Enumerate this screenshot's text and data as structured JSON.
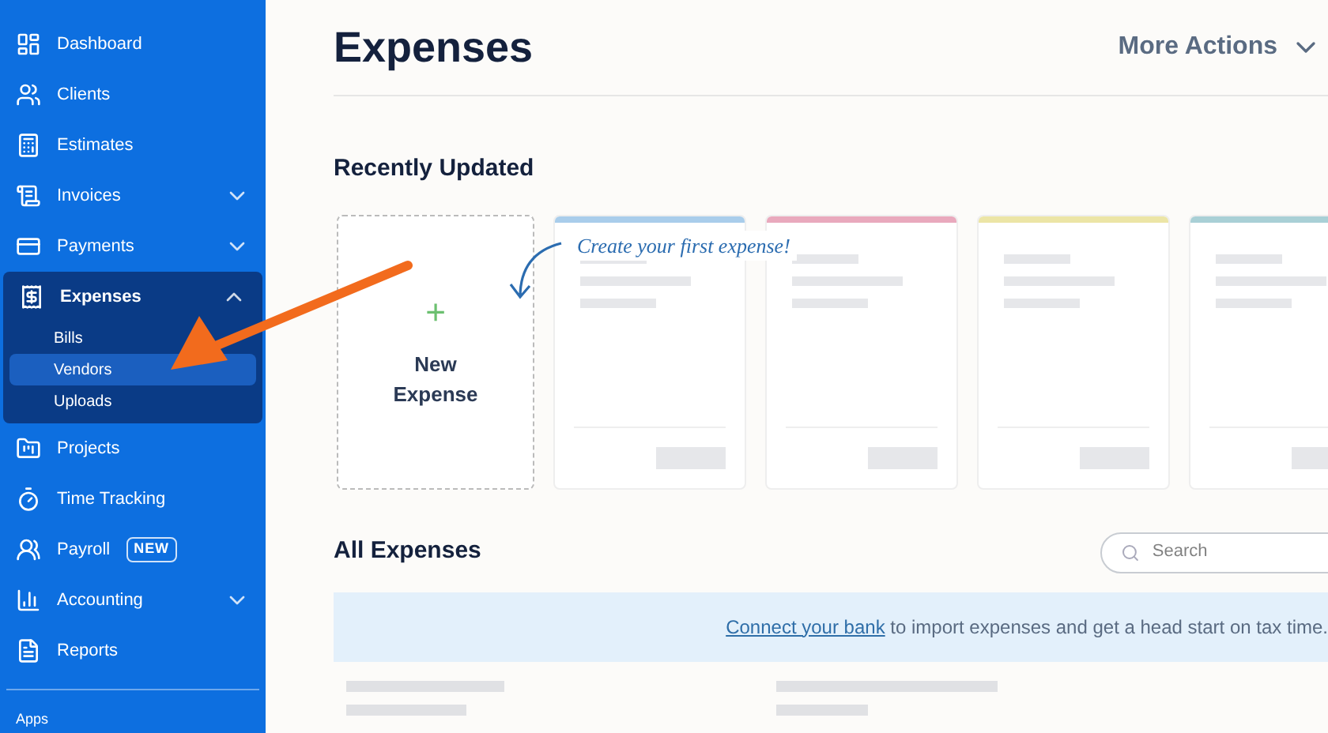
{
  "sidebar": {
    "items": [
      {
        "label": "Dashboard"
      },
      {
        "label": "Clients"
      },
      {
        "label": "Estimates"
      },
      {
        "label": "Invoices",
        "expanded": false
      },
      {
        "label": "Payments",
        "expanded": false
      },
      {
        "label": "Expenses",
        "expanded": true,
        "children": [
          {
            "label": "Bills",
            "selected": false
          },
          {
            "label": "Vendors",
            "selected": true
          },
          {
            "label": "Uploads",
            "selected": false
          }
        ]
      },
      {
        "label": "Projects"
      },
      {
        "label": "Time Tracking"
      },
      {
        "label": "Payroll",
        "badge": "NEW"
      },
      {
        "label": "Accounting",
        "expanded": false
      },
      {
        "label": "Reports"
      }
    ],
    "footer": "Apps"
  },
  "page": {
    "title": "Expenses",
    "more_actions": "More Actions"
  },
  "recently_updated": {
    "heading": "Recently Updated",
    "new_card": {
      "icon": "+",
      "label": "New Expense"
    },
    "hint": "Create your first expense!",
    "placeholder_cards": [
      {
        "color": "#a9cdeb"
      },
      {
        "color": "#e9a9bd"
      },
      {
        "color": "#ece5a6"
      },
      {
        "color": "#a9d0d6"
      }
    ]
  },
  "all_expenses": {
    "heading": "All Expenses",
    "search": {
      "placeholder": "Search"
    },
    "banner": {
      "link": "Connect your bank",
      "text": " to import expenses and get a head start on tax time."
    }
  }
}
